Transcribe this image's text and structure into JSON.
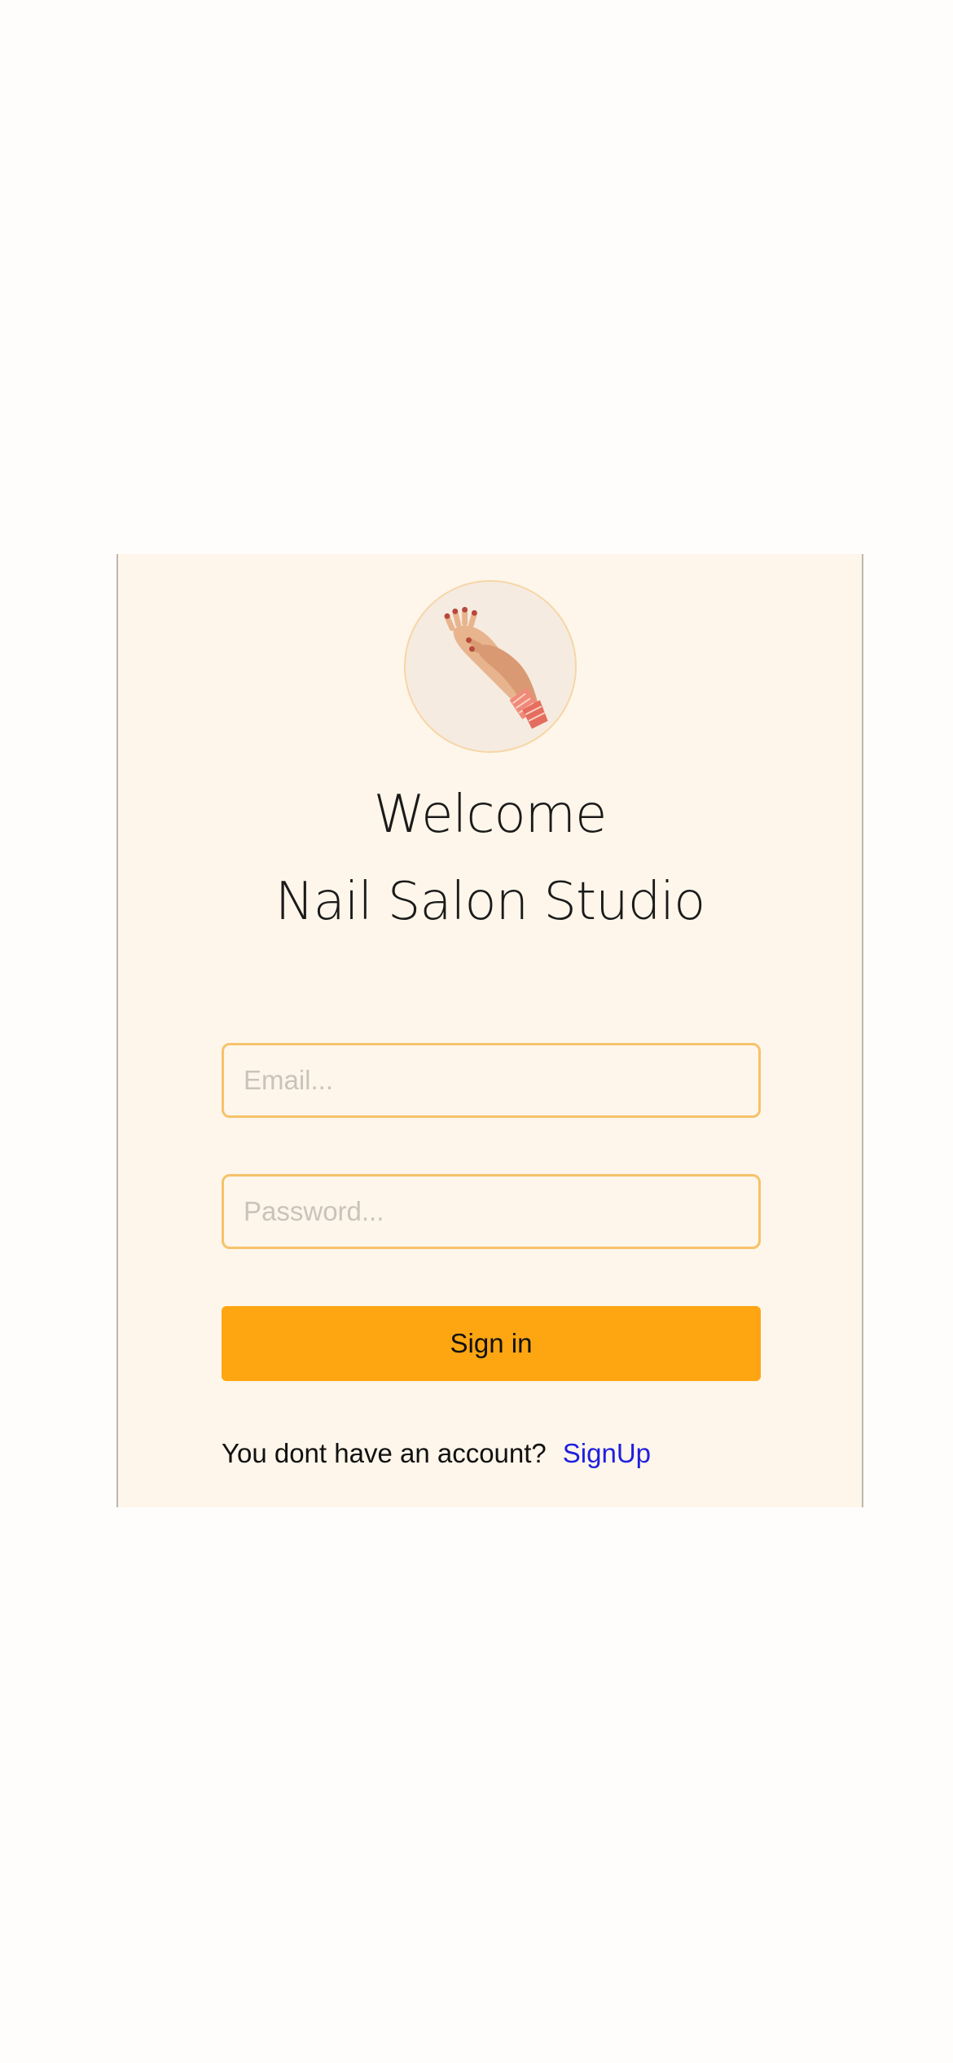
{
  "brand": {
    "logo_icon": "hands-manicure-icon",
    "accent_color": "#fea512",
    "background_color": "#fef6ea"
  },
  "header": {
    "welcome": "Welcome",
    "app_name": "Nail Salon Studio"
  },
  "form": {
    "email": {
      "value": "",
      "placeholder": "Email..."
    },
    "password": {
      "value": "",
      "placeholder": "Password..."
    },
    "signin_label": "Sign in"
  },
  "footer": {
    "prompt": "You dont have an account?",
    "signup_label": "SignUp",
    "link_color": "#1f1fe0"
  }
}
